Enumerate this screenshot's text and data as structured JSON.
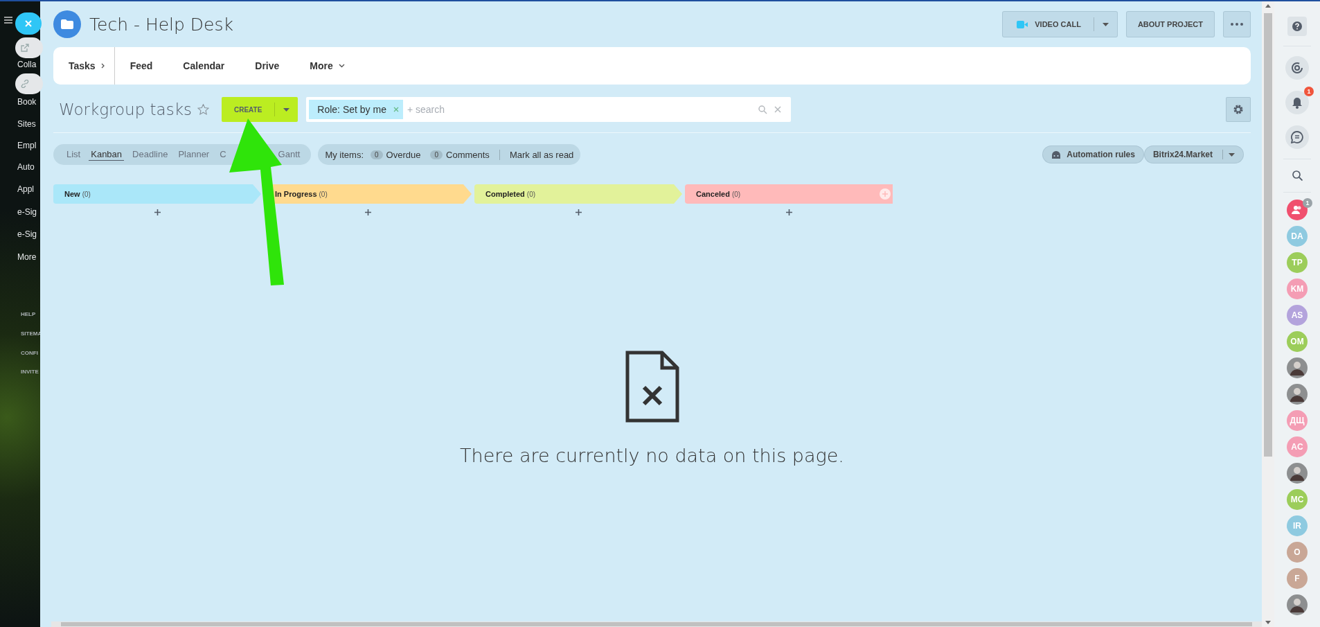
{
  "sidebar": {
    "items": [
      {
        "label": "Colla"
      },
      {
        "label": "Book"
      },
      {
        "label": "Sites"
      },
      {
        "label": "Empl"
      },
      {
        "label": "Auto"
      },
      {
        "label": "Appl"
      },
      {
        "label": "e-Sig"
      },
      {
        "label": "e-Sig"
      },
      {
        "label": "More"
      }
    ],
    "footer_links": [
      "HELP",
      "SITEMA",
      "CONFI",
      "INVITE"
    ]
  },
  "header": {
    "title": "Tech - Help Desk",
    "video_call": "VIDEO CALL",
    "about": "ABOUT PROJECT"
  },
  "nav": {
    "items": [
      {
        "label": "Tasks",
        "kind": "root"
      },
      {
        "label": "Feed",
        "kind": "plain"
      },
      {
        "label": "Calendar",
        "kind": "plain"
      },
      {
        "label": "Drive",
        "kind": "plain"
      },
      {
        "label": "More",
        "kind": "dropdown"
      }
    ]
  },
  "toolbar": {
    "title": "Workgroup tasks",
    "create": "CREATE",
    "filter_chip": "Role: Set by me",
    "placeholder": "+ search"
  },
  "views": [
    {
      "label": "List",
      "selected": false
    },
    {
      "label": "Kanban",
      "selected": true
    },
    {
      "label": "Deadline",
      "selected": false
    },
    {
      "label": "Planner",
      "selected": false
    },
    {
      "label": "C",
      "selected": false
    },
    {
      "label": "Gantt",
      "selected": false
    }
  ],
  "counters": {
    "label": "My items:",
    "items": [
      {
        "count": "0",
        "label": "Overdue"
      },
      {
        "count": "0",
        "label": "Comments"
      }
    ],
    "mark_all": "Mark all as read"
  },
  "tools": {
    "automation": "Automation rules",
    "market": "Bitrix24.Market"
  },
  "columns": [
    {
      "title": "New",
      "count": "(0)",
      "color": "#aae7f9",
      "add_icon": false
    },
    {
      "title": "In Progress",
      "count": "(0)",
      "color": "#ffda8e",
      "add_icon": false
    },
    {
      "title": "Completed",
      "count": "(0)",
      "color": "#e2f29a",
      "add_icon": false
    },
    {
      "title": "Canceled",
      "count": "(0)",
      "color": "#ffbaba",
      "add_icon": true
    }
  ],
  "empty_message": "There are currently no data on this page.",
  "right_bar": {
    "notifications_badge": "1",
    "contacts": [
      {
        "kind": "group",
        "badge": "1",
        "color": "#f0506e"
      },
      {
        "kind": "initials",
        "initials": "DA",
        "color": "#8ecae0"
      },
      {
        "kind": "initials",
        "initials": "TP",
        "color": "#9ccd5a"
      },
      {
        "kind": "initials",
        "initials": "KM",
        "color": "#f49db4"
      },
      {
        "kind": "initials",
        "initials": "AS",
        "color": "#b3a3dc"
      },
      {
        "kind": "initials",
        "initials": "OM",
        "color": "#9ccd5a"
      },
      {
        "kind": "photo"
      },
      {
        "kind": "photo"
      },
      {
        "kind": "initials",
        "initials": "ДЩ",
        "color": "#f49db4"
      },
      {
        "kind": "initials",
        "initials": "AC",
        "color": "#f49db4"
      },
      {
        "kind": "photo"
      },
      {
        "kind": "initials",
        "initials": "MC",
        "color": "#9ccd5a"
      },
      {
        "kind": "initials",
        "initials": "IR",
        "color": "#8ecae0"
      },
      {
        "kind": "initials",
        "initials": "O",
        "color": "#c9a796"
      },
      {
        "kind": "initials",
        "initials": "F",
        "color": "#c9a796"
      },
      {
        "kind": "photo"
      }
    ]
  }
}
